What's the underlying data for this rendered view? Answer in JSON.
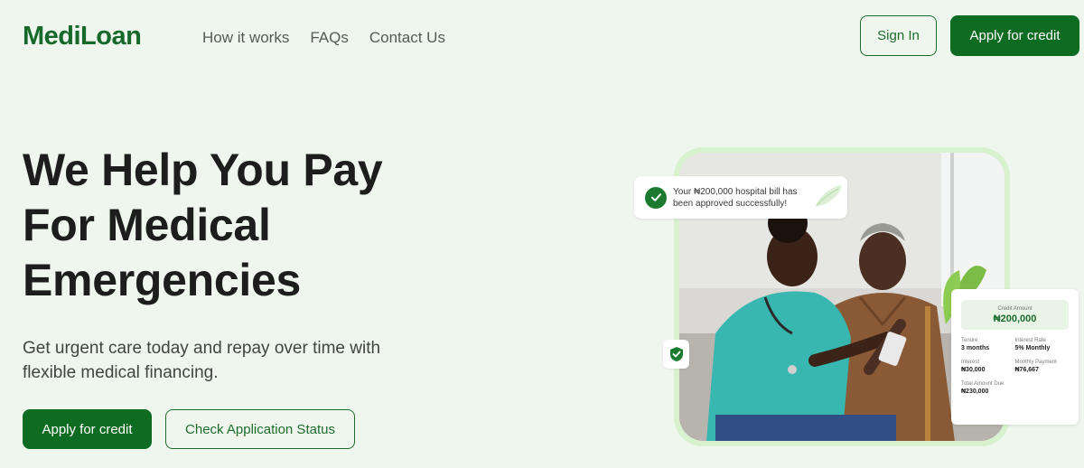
{
  "brand": {
    "name": "MediLoan"
  },
  "nav": {
    "links": [
      "How it works",
      "FAQs",
      "Contact Us"
    ],
    "sign_in": "Sign In",
    "apply": "Apply for credit"
  },
  "hero": {
    "title": "We Help You Pay For Medical Emergencies",
    "subtitle": "Get urgent care today and repay over time with flexible medical financing.",
    "cta_apply": "Apply for credit",
    "cta_status": "Check Application Status"
  },
  "notification": {
    "text": "Your ₦200,000 hospital bill has been approved successfully!",
    "icon": "check-circle-icon"
  },
  "credit_card": {
    "amount_label": "Credit Amount",
    "amount_value": "₦200,000",
    "rows": [
      {
        "label": "Tenure",
        "value": "3 months"
      },
      {
        "label": "Interest Rate",
        "value": "5% Monthly"
      },
      {
        "label": "Interest",
        "value": "₦30,000"
      },
      {
        "label": "Monthly Payment",
        "value": "₦76,667"
      },
      {
        "label": "Total Amount Due",
        "value": "₦230,000"
      }
    ]
  },
  "colors": {
    "background": "#eef6ee",
    "brand": "#16692a",
    "primary_button": "#0e6b22",
    "frame": "#d8f2cf"
  },
  "icons": [
    "check-circle-icon",
    "shield-check-icon",
    "leaf-icon"
  ]
}
